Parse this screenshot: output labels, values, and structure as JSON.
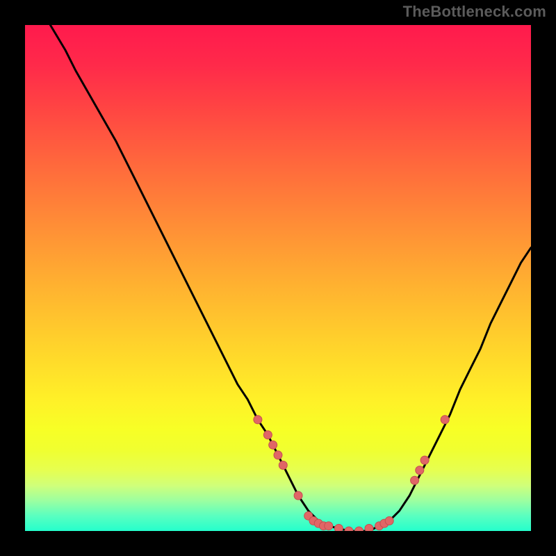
{
  "watermark": "TheBottleneck.com",
  "colors": {
    "background": "#000000",
    "gradient_top": "#ff1a4d",
    "gradient_mid": "#ffd52b",
    "gradient_bottom": "#24ffcc",
    "curve_stroke": "#000000",
    "marker_fill": "#e06666",
    "marker_stroke": "#c44f4f"
  },
  "chart_data": {
    "type": "line",
    "title": "",
    "xlabel": "",
    "ylabel": "",
    "xlim": [
      0,
      100
    ],
    "ylim": [
      0,
      100
    ],
    "grid": false,
    "legend": false,
    "curve": [
      {
        "x": 5,
        "y": 100
      },
      {
        "x": 8,
        "y": 95
      },
      {
        "x": 10,
        "y": 91
      },
      {
        "x": 14,
        "y": 84
      },
      {
        "x": 18,
        "y": 77
      },
      {
        "x": 22,
        "y": 69
      },
      {
        "x": 26,
        "y": 61
      },
      {
        "x": 30,
        "y": 53
      },
      {
        "x": 34,
        "y": 45
      },
      {
        "x": 38,
        "y": 37
      },
      {
        "x": 42,
        "y": 29
      },
      {
        "x": 44,
        "y": 26
      },
      {
        "x": 46,
        "y": 22
      },
      {
        "x": 48,
        "y": 19
      },
      {
        "x": 50,
        "y": 15
      },
      {
        "x": 52,
        "y": 11
      },
      {
        "x": 54,
        "y": 7
      },
      {
        "x": 56,
        "y": 4
      },
      {
        "x": 58,
        "y": 2
      },
      {
        "x": 60,
        "y": 1
      },
      {
        "x": 64,
        "y": 0
      },
      {
        "x": 68,
        "y": 0
      },
      {
        "x": 70,
        "y": 1
      },
      {
        "x": 72,
        "y": 2
      },
      {
        "x": 74,
        "y": 4
      },
      {
        "x": 76,
        "y": 7
      },
      {
        "x": 78,
        "y": 11
      },
      {
        "x": 80,
        "y": 15
      },
      {
        "x": 82,
        "y": 19
      },
      {
        "x": 84,
        "y": 23
      },
      {
        "x": 86,
        "y": 28
      },
      {
        "x": 88,
        "y": 32
      },
      {
        "x": 90,
        "y": 36
      },
      {
        "x": 92,
        "y": 41
      },
      {
        "x": 94,
        "y": 45
      },
      {
        "x": 96,
        "y": 49
      },
      {
        "x": 98,
        "y": 53
      },
      {
        "x": 100,
        "y": 56
      }
    ],
    "markers": [
      {
        "x": 46,
        "y": 22
      },
      {
        "x": 48,
        "y": 19
      },
      {
        "x": 49,
        "y": 17
      },
      {
        "x": 50,
        "y": 15
      },
      {
        "x": 51,
        "y": 13
      },
      {
        "x": 54,
        "y": 7
      },
      {
        "x": 56,
        "y": 3
      },
      {
        "x": 57,
        "y": 2
      },
      {
        "x": 58,
        "y": 1.5
      },
      {
        "x": 59,
        "y": 1
      },
      {
        "x": 60,
        "y": 1
      },
      {
        "x": 62,
        "y": 0.5
      },
      {
        "x": 64,
        "y": 0
      },
      {
        "x": 66,
        "y": 0
      },
      {
        "x": 68,
        "y": 0.5
      },
      {
        "x": 70,
        "y": 1
      },
      {
        "x": 71,
        "y": 1.5
      },
      {
        "x": 72,
        "y": 2
      },
      {
        "x": 77,
        "y": 10
      },
      {
        "x": 78,
        "y": 12
      },
      {
        "x": 79,
        "y": 14
      },
      {
        "x": 83,
        "y": 22
      }
    ]
  }
}
